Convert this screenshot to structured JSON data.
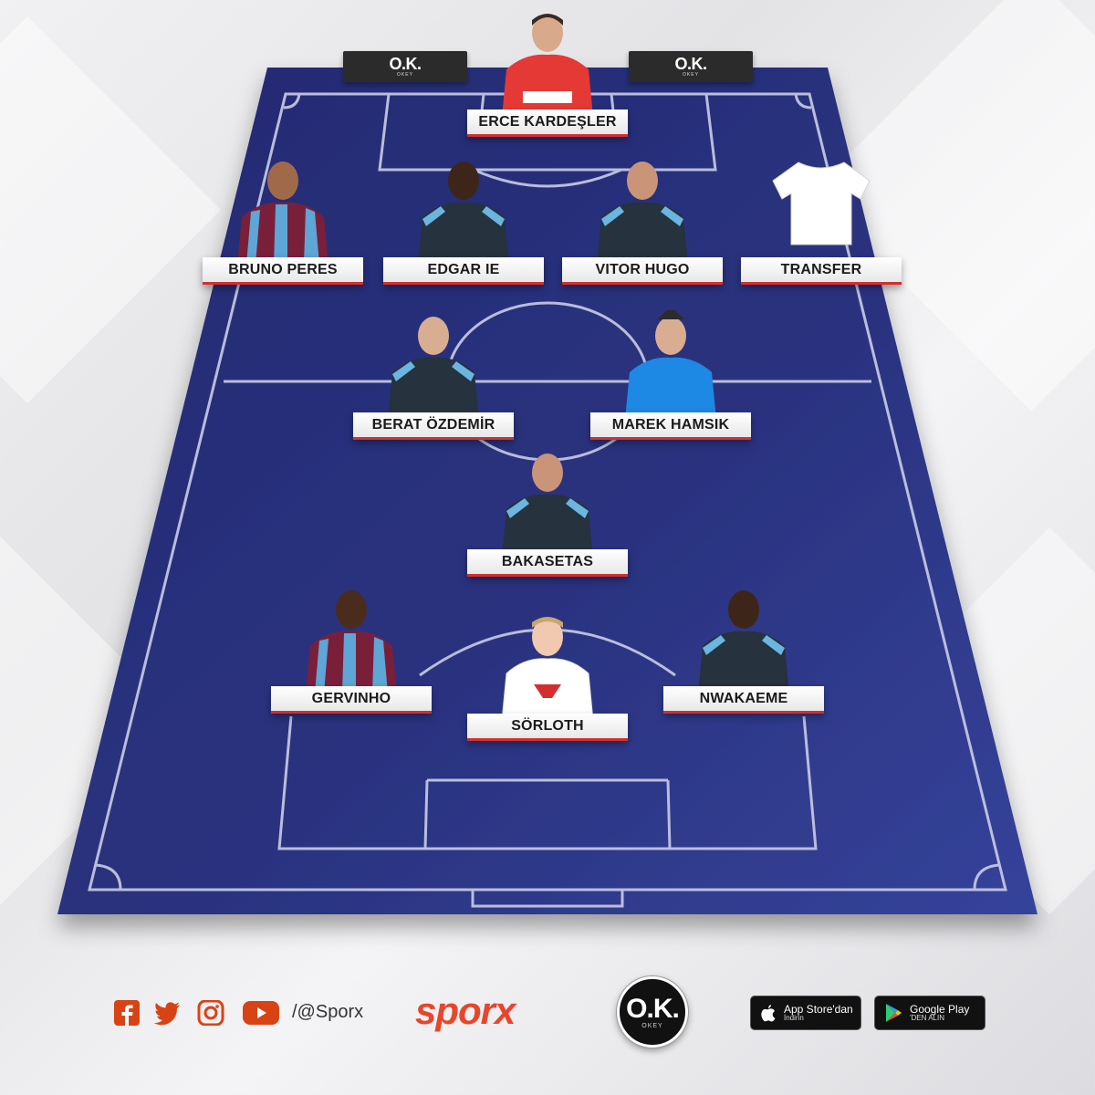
{
  "sponsor": {
    "mark": "O.K.",
    "sub": "OKEY"
  },
  "players": [
    {
      "name": "ERCE KARDEŞLER",
      "kit": "red"
    },
    {
      "name": "BRUNO PERES",
      "kit": "striped"
    },
    {
      "name": "EDGAR IE",
      "kit": "dark"
    },
    {
      "name": "VITOR HUGO",
      "kit": "dark"
    },
    {
      "name": "TRANSFER",
      "kit": "placeholder"
    },
    {
      "name": "BERAT ÖZDEMİR",
      "kit": "dark"
    },
    {
      "name": "MAREK HAMSIK",
      "kit": "blue"
    },
    {
      "name": "BAKASETAS",
      "kit": "dark"
    },
    {
      "name": "GERVINHO",
      "kit": "striped"
    },
    {
      "name": "SÖRLOTH",
      "kit": "white"
    },
    {
      "name": "NWAKAEME",
      "kit": "dark"
    }
  ],
  "footer": {
    "social_icons": [
      "facebook-icon",
      "twitter-icon",
      "instagram-icon",
      "youtube-icon"
    ],
    "handle": "/@Sporx",
    "brand": "sporx",
    "okey_mark": "O.K.",
    "okey_sub": "OKEY",
    "app_store": {
      "line1": "App Store'dan",
      "line2": "İndirin"
    },
    "google_play": {
      "line1": "Google Play",
      "line2": "'DEN ALIN"
    }
  },
  "colors": {
    "pitch": "#2a317a",
    "pitch_dark": "#1f2564",
    "label_accent": "#d32f2f",
    "brand": "#e8452a"
  }
}
